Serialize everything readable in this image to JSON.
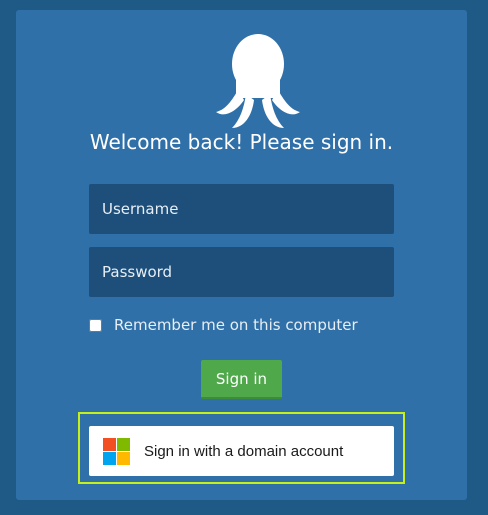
{
  "login": {
    "title": "Welcome back! Please sign in.",
    "username_placeholder": "Username",
    "password_placeholder": "Password",
    "remember_label": "Remember me on this computer",
    "signin_label": "Sign in",
    "domain_signin_label": "Sign in with a domain account"
  },
  "icons": {
    "logo": "octopus-logo-icon",
    "domain": "microsoft-windows-icon"
  },
  "colors": {
    "page_background": "#1f5a86",
    "card_background": "#3070a8",
    "field_background": "#1d4f7a",
    "signin_button": "#4fa94b",
    "highlight_border": "#c7f01a",
    "ms_red": "#f25022",
    "ms_green": "#7fba00",
    "ms_blue": "#00a4ef",
    "ms_yellow": "#ffb900"
  }
}
